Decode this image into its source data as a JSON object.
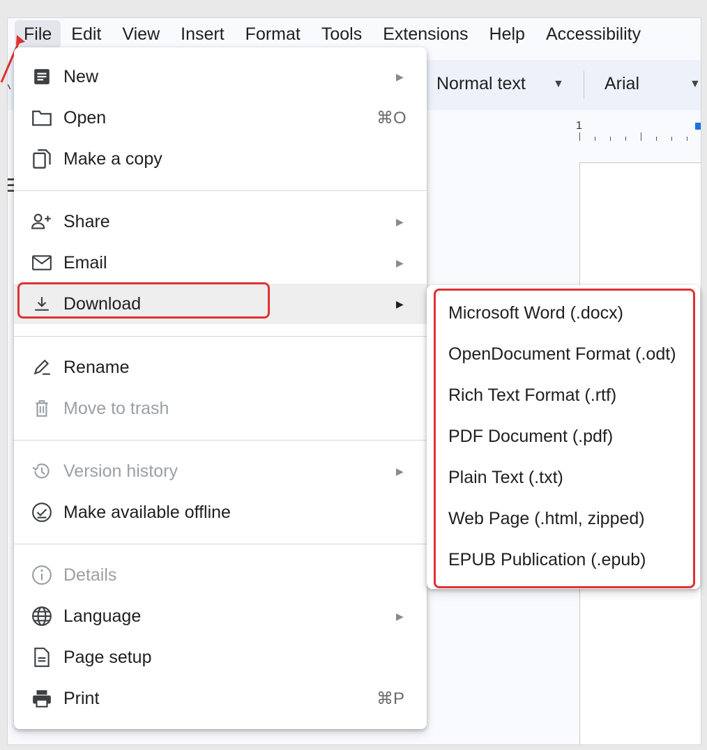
{
  "menubar": {
    "items": [
      "File",
      "Edit",
      "View",
      "Insert",
      "Format",
      "Tools",
      "Extensions",
      "Help",
      "Accessibility"
    ]
  },
  "toolbar": {
    "paragraph_style": "Normal text",
    "font": "Arial"
  },
  "ruler": {
    "marker": "1"
  },
  "file_menu": {
    "new": {
      "label": "New",
      "icon": "document-icon"
    },
    "open": {
      "label": "Open",
      "shortcut": "⌘O",
      "icon": "folder-icon"
    },
    "copy": {
      "label": "Make a copy",
      "icon": "copy-icon"
    },
    "share": {
      "label": "Share",
      "icon": "add-person-icon"
    },
    "email": {
      "label": "Email",
      "icon": "mail-icon"
    },
    "download": {
      "label": "Download",
      "icon": "download-icon"
    },
    "rename": {
      "label": "Rename",
      "icon": "pencil-icon"
    },
    "trash": {
      "label": "Move to trash",
      "icon": "trash-icon"
    },
    "version": {
      "label": "Version history",
      "icon": "history-icon"
    },
    "offline": {
      "label": "Make available offline",
      "icon": "offline-check-icon"
    },
    "details": {
      "label": "Details",
      "icon": "info-icon"
    },
    "language": {
      "label": "Language",
      "icon": "globe-icon"
    },
    "page_setup": {
      "label": "Page setup",
      "icon": "page-icon"
    },
    "print": {
      "label": "Print",
      "shortcut": "⌘P",
      "icon": "printer-icon"
    }
  },
  "download_submenu": {
    "items": [
      "Microsoft Word (.docx)",
      "OpenDocument Format (.odt)",
      "Rich Text Format (.rtf)",
      "PDF Document (.pdf)",
      "Plain Text (.txt)",
      "Web Page (.html, zipped)",
      "EPUB Publication (.epub)"
    ]
  },
  "colors": {
    "highlight": "#e03131",
    "hover": "#eeeeef",
    "disabled": "#9aa0a6"
  }
}
